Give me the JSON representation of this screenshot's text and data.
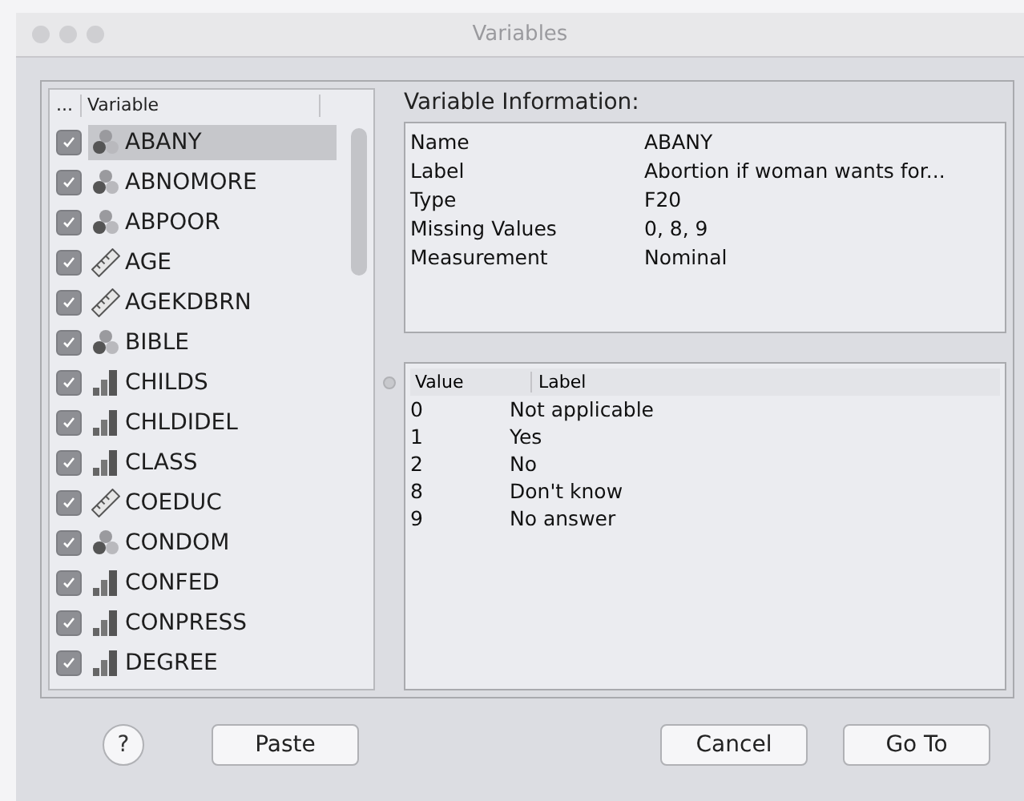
{
  "window": {
    "title": "Variables"
  },
  "variable_list": {
    "columns": [
      "...",
      "Variable"
    ],
    "items": [
      {
        "name": "ABANY",
        "kind": "nominal",
        "checked": true,
        "selected": true
      },
      {
        "name": "ABNOMORE",
        "kind": "nominal",
        "checked": true,
        "selected": false
      },
      {
        "name": "ABPOOR",
        "kind": "nominal",
        "checked": true,
        "selected": false
      },
      {
        "name": "AGE",
        "kind": "scale",
        "checked": true,
        "selected": false
      },
      {
        "name": "AGEKDBRN",
        "kind": "scale",
        "checked": true,
        "selected": false
      },
      {
        "name": "BIBLE",
        "kind": "nominal",
        "checked": true,
        "selected": false
      },
      {
        "name": "CHILDS",
        "kind": "ordinal",
        "checked": true,
        "selected": false
      },
      {
        "name": "CHLDIDEL",
        "kind": "ordinal",
        "checked": true,
        "selected": false
      },
      {
        "name": "CLASS",
        "kind": "ordinal",
        "checked": true,
        "selected": false
      },
      {
        "name": "COEDUC",
        "kind": "scale",
        "checked": true,
        "selected": false
      },
      {
        "name": "CONDOM",
        "kind": "nominal",
        "checked": true,
        "selected": false
      },
      {
        "name": "CONFED",
        "kind": "ordinal",
        "checked": true,
        "selected": false
      },
      {
        "name": "CONPRESS",
        "kind": "ordinal",
        "checked": true,
        "selected": false
      },
      {
        "name": "DEGREE",
        "kind": "ordinal",
        "checked": true,
        "selected": false
      }
    ]
  },
  "variable_information": {
    "title": "Variable Information:",
    "rows": [
      {
        "label": "Name",
        "value": "ABANY"
      },
      {
        "label": "Label",
        "value": "Abortion if woman wants for..."
      },
      {
        "label": "Type",
        "value": "F20"
      },
      {
        "label": "Missing Values",
        "value": "0, 8, 9"
      },
      {
        "label": "Measurement",
        "value": "Nominal"
      }
    ]
  },
  "value_labels": {
    "columns": [
      "Value",
      "Label"
    ],
    "rows": [
      {
        "value": "0",
        "label": "Not applicable"
      },
      {
        "value": "1",
        "label": "Yes"
      },
      {
        "value": "2",
        "label": "No"
      },
      {
        "value": "8",
        "label": "Don't know"
      },
      {
        "value": "9",
        "label": "No answer"
      }
    ]
  },
  "buttons": {
    "help": "?",
    "paste": "Paste",
    "cancel": "Cancel",
    "go_to": "Go To"
  }
}
